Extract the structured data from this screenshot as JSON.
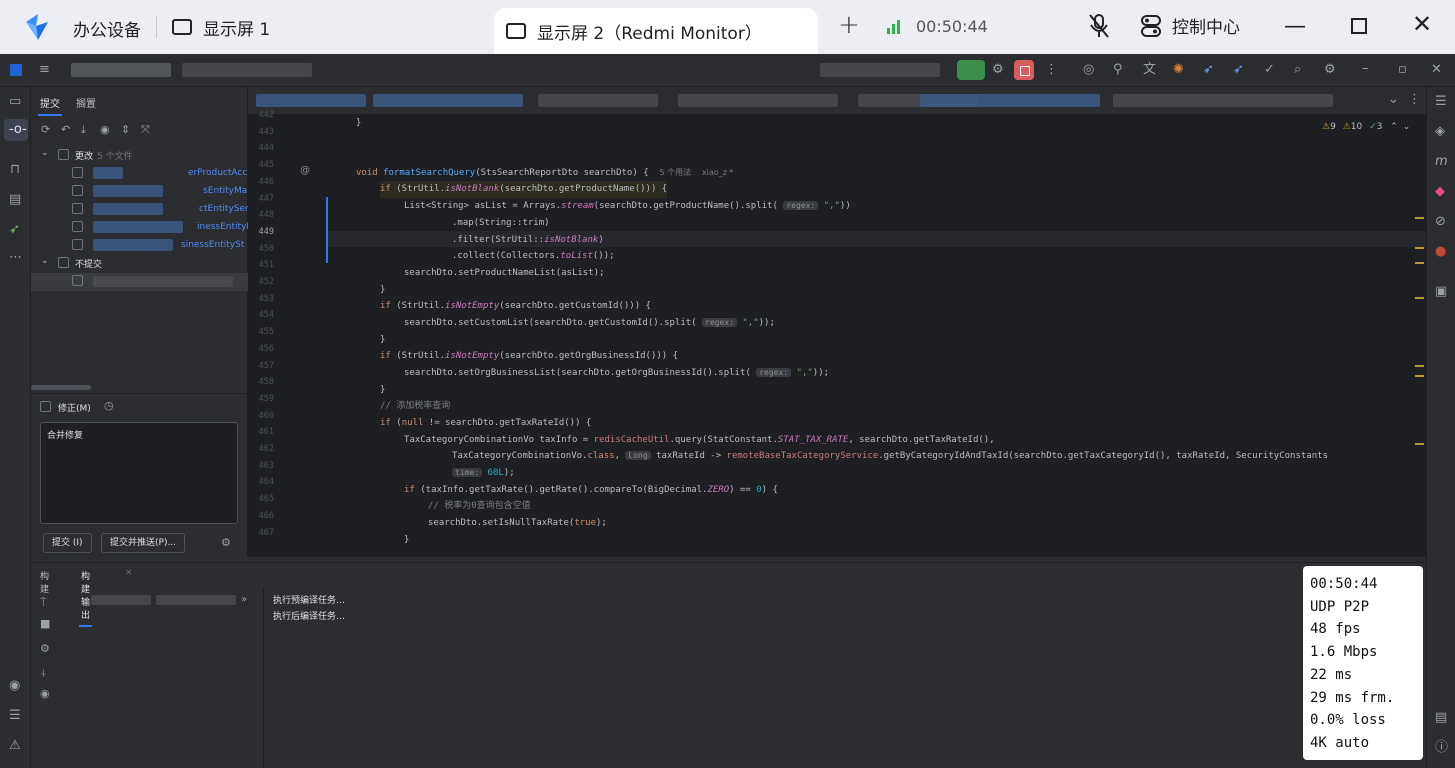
{
  "remote": {
    "app_title": "办公设备",
    "tab1_label": "显示屏 1",
    "tab2_label": "显示屏 2（Redmi Monitor）",
    "time": "00:50:44",
    "control_center": "控制中心"
  },
  "ide": {
    "commit_tabs": [
      "提交",
      "搁置"
    ],
    "changes_group": "更改",
    "changes_count": "5 个文件",
    "changed_files": [
      "erProductAcc",
      "sEntityMap",
      "ctEntitySer",
      "inessEntityM",
      "sinessEntitySt"
    ],
    "unversioned_group": "不提交",
    "amend_label": "修正(M)",
    "commit_message": "合并修复",
    "commit_button": "提交 (I)",
    "commit_push_button": "提交并推送(P)...",
    "inspections": {
      "warnings": "9",
      "weak": "10",
      "ok": "3"
    },
    "bottom_tabs": [
      "构建",
      "构建输出"
    ],
    "output_lines": [
      "执行预编译任务…",
      "执行后编译任务…"
    ]
  },
  "code": {
    "line_numbers": [
      "442",
      "443",
      "444",
      "445",
      "446",
      "447",
      "448",
      "449",
      "450",
      "451",
      "452",
      "453",
      "454",
      "455",
      "456",
      "457",
      "458",
      "459",
      "460",
      "461",
      "462",
      "463",
      "464",
      "465",
      "466",
      "467"
    ],
    "usage_hint": "5 个用法",
    "author": "xiao_z *",
    "comment_tax": "// 添加税率查询",
    "comment_zero": "// 税率为0查询包含空值"
  },
  "stats_overlay": [
    "00:50:44",
    "UDP P2P",
    "48 fps",
    "1.6 Mbps",
    "22 ms",
    "29 ms frm.",
    "0.0% loss",
    "4K auto"
  ]
}
